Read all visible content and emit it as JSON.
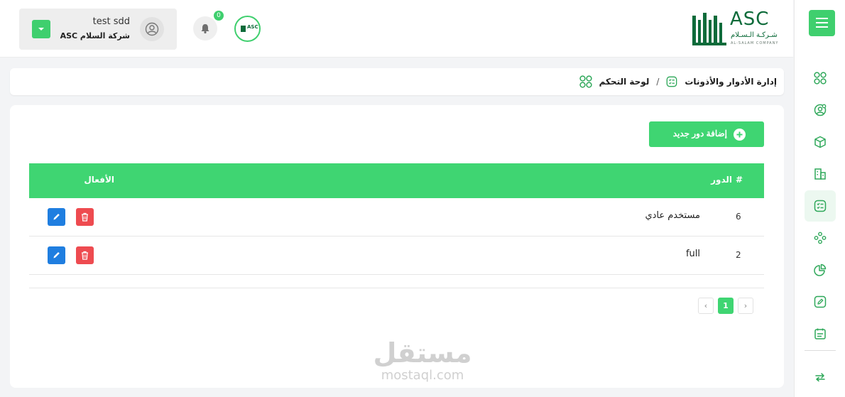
{
  "header": {
    "user_name": "test sdd",
    "user_company": "شركة السلام ASC",
    "notification_count": "0",
    "mini_logo_text": "ASC",
    "brand": {
      "asc": "ASC",
      "arabic": "شـركـة الـسـلام",
      "english": "AL-SALAM COMPANY"
    }
  },
  "breadcrumb": {
    "home": "لوحة التحكم",
    "separator": "/",
    "current": "إدارة الأدوار والأذونات"
  },
  "toolbar": {
    "add_label": "إضافة دور جديد"
  },
  "table": {
    "columns": {
      "index": "#",
      "role": "الدور",
      "actions": "الأفعال"
    },
    "rows": [
      {
        "id": "6",
        "name": "مستخدم عادي"
      },
      {
        "id": "2",
        "name": "full"
      }
    ]
  },
  "pagination": {
    "current": "1",
    "prev": "‹",
    "next": "›"
  },
  "watermark": {
    "arabic": "مستقل",
    "english": "mostaql.com"
  },
  "colors": {
    "accent": "#3fd572",
    "edit": "#1f7ee0",
    "delete": "#ee4b50",
    "brand": "#0d6b3a"
  },
  "sidebar": {
    "icons": [
      "menu-icon",
      "dashboard-icon",
      "user-settings-icon",
      "package-icon",
      "building-icon",
      "roles-icon",
      "users-group-icon",
      "pie-chart-icon",
      "edit-document-icon",
      "calendar-list-icon",
      "swap-arrows-icon"
    ],
    "active": "roles-icon"
  }
}
